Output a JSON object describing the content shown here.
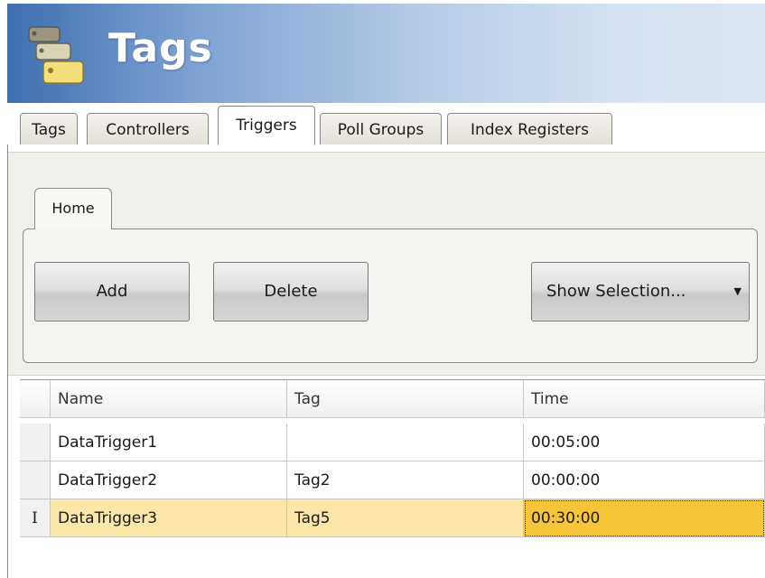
{
  "header": {
    "title": "Tags",
    "icon": "tags-folder-icon"
  },
  "tabs": [
    {
      "label": "Tags",
      "active": false
    },
    {
      "label": "Controllers",
      "active": false
    },
    {
      "label": "Triggers",
      "active": true
    },
    {
      "label": "Poll Groups",
      "active": false
    },
    {
      "label": "Index Registers",
      "active": false
    }
  ],
  "ribbon": {
    "tab_label": "Home",
    "add_label": "Add",
    "delete_label": "Delete",
    "show_selection_label": "Show Selection..."
  },
  "grid": {
    "columns": [
      "Name",
      "Tag",
      "Time"
    ],
    "rows": [
      {
        "name": "DataTrigger1",
        "tag": "",
        "time": "00:05:00",
        "selected": false
      },
      {
        "name": "DataTrigger2",
        "tag": "Tag2",
        "time": "00:00:00",
        "selected": false
      },
      {
        "name": "DataTrigger3",
        "tag": "Tag5",
        "time": "00:30:00",
        "selected": true,
        "editing": true
      }
    ],
    "edit_indicator": "I"
  },
  "colors": {
    "header_blue": "#3f6fb0",
    "selected_row": "#fde7a8",
    "current_cell": "#f7c53a"
  }
}
